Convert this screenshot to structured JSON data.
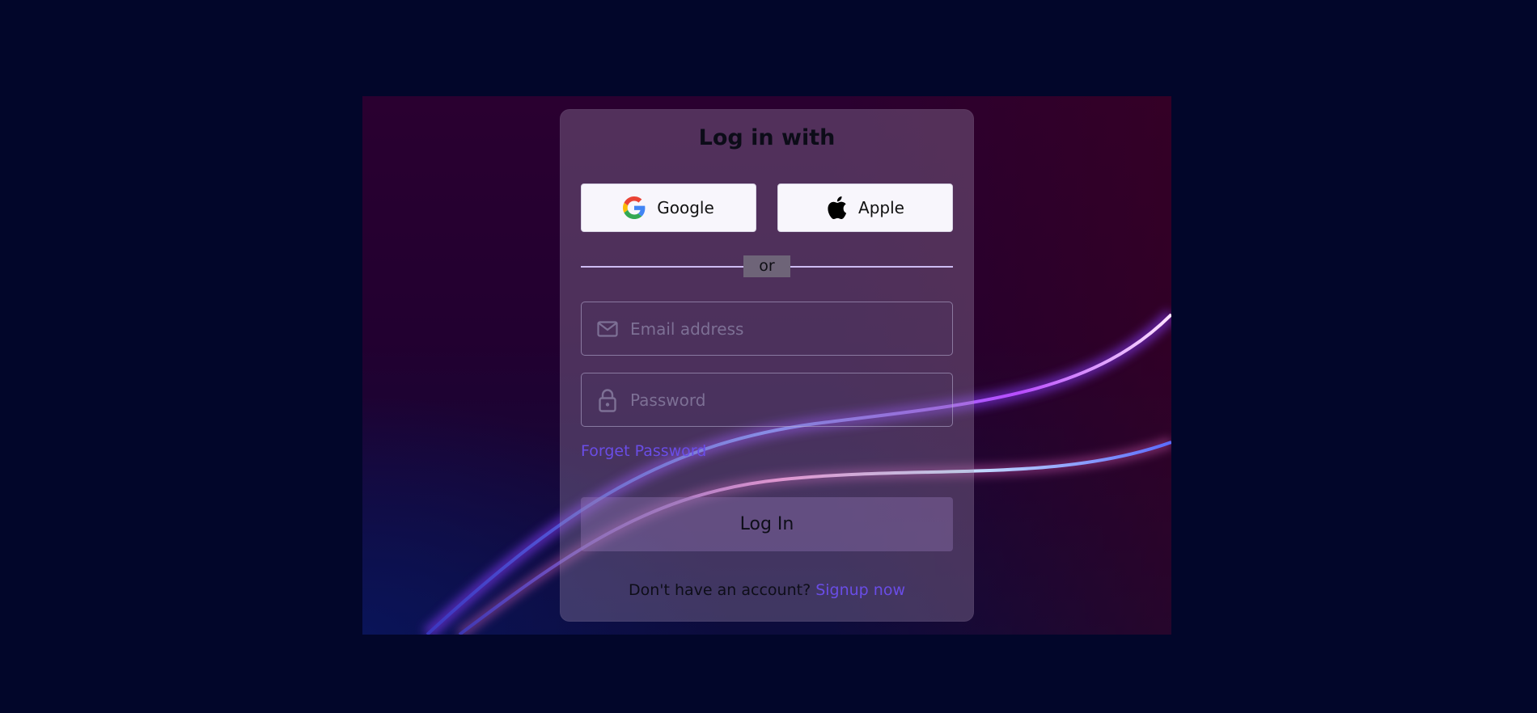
{
  "login": {
    "title": "Log in with",
    "social": {
      "google": {
        "label": "Google",
        "icon": "google-icon"
      },
      "apple": {
        "label": "Apple",
        "icon": "apple-icon"
      }
    },
    "divider": "or",
    "email": {
      "placeholder": "Email address",
      "value": "",
      "icon": "mail-icon"
    },
    "password": {
      "placeholder": "Password",
      "value": "",
      "icon": "lock-icon"
    },
    "forgot_label": "Forget Password",
    "submit_label": "Log In",
    "signup_prompt": "Don't have an account?",
    "signup_link": "Signup now"
  },
  "colors": {
    "page_background": "#02062a",
    "link": "#6a4de6",
    "divider": "#cdbcf2"
  }
}
